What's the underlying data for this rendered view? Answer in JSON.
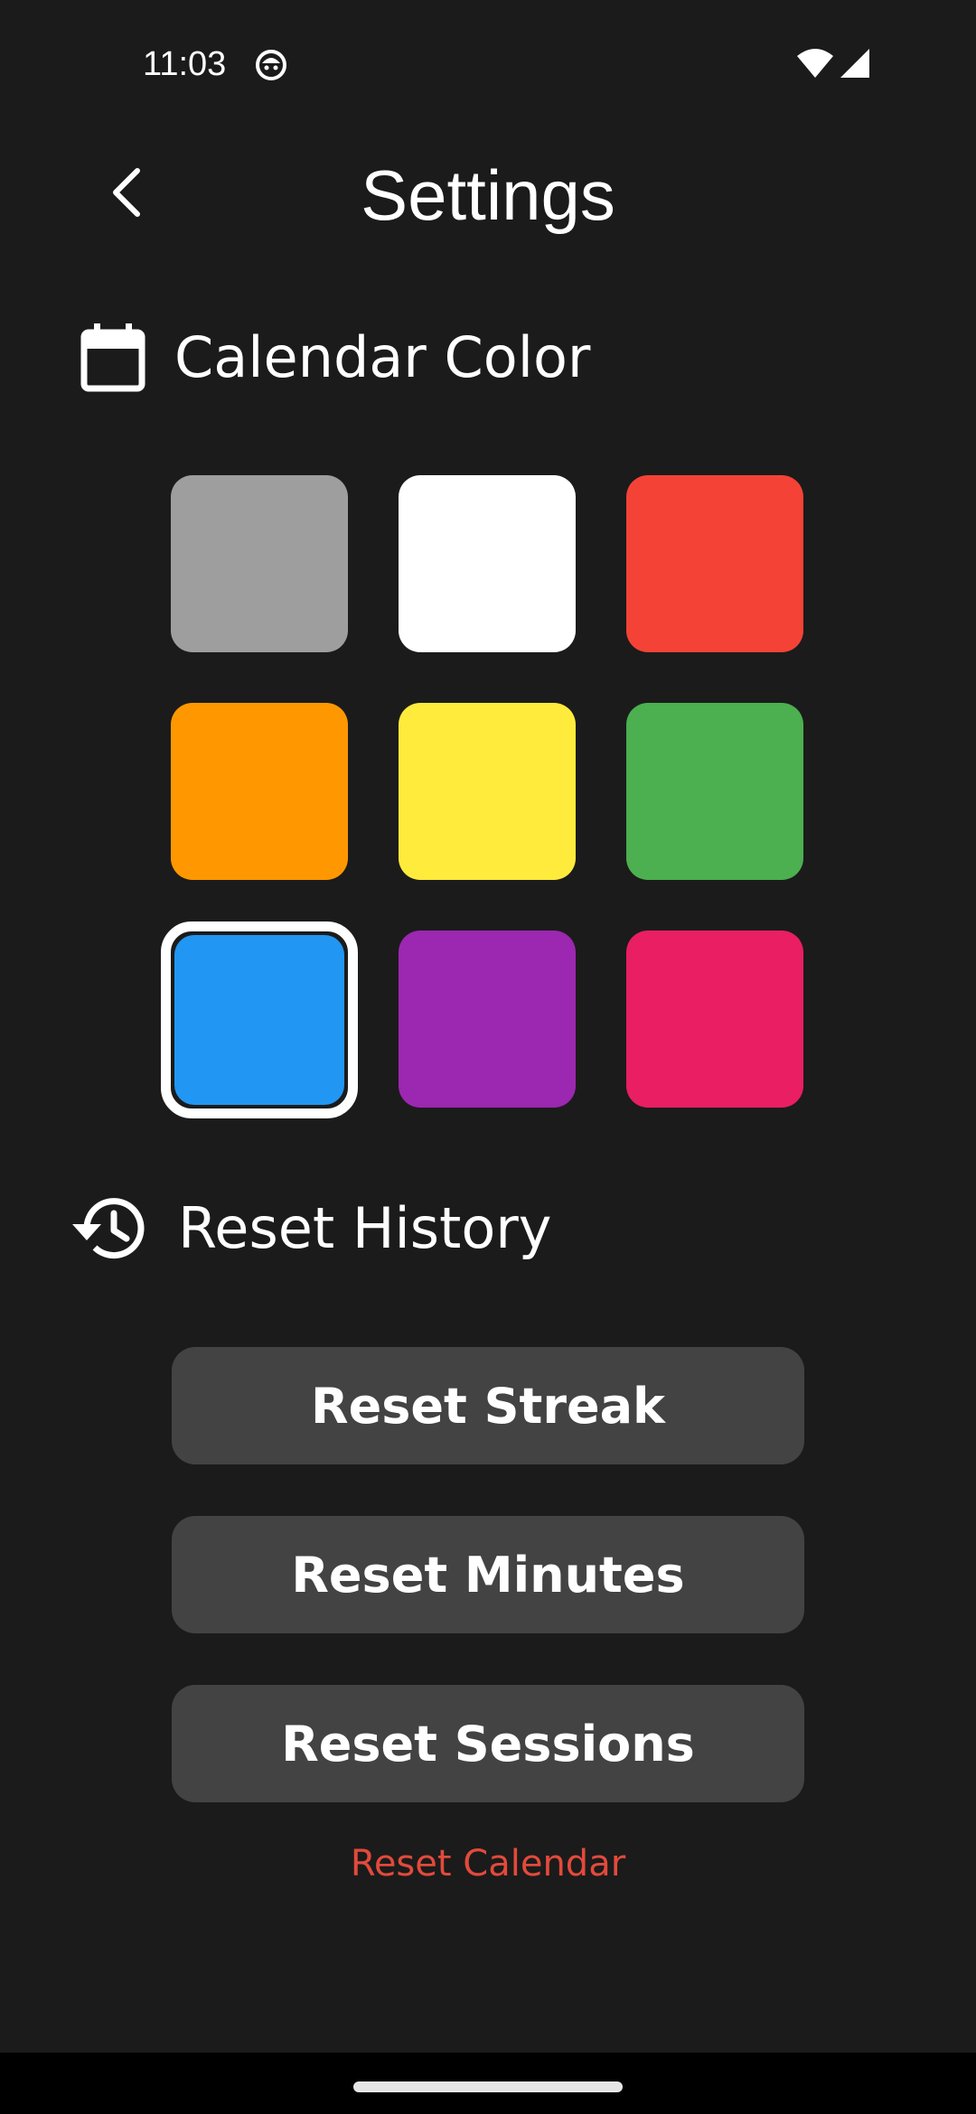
{
  "status_bar": {
    "time": "11:03",
    "icons": [
      "notification-face-icon",
      "wifi-icon",
      "signal-icon"
    ]
  },
  "header": {
    "back_icon": "chevron-left-icon",
    "title": "Settings"
  },
  "calendar_color": {
    "icon": "calendar-icon",
    "label": "Calendar Color",
    "selected_index": 6,
    "swatches": [
      {
        "name": "gray",
        "color": "#9e9e9e"
      },
      {
        "name": "white",
        "color": "#ffffff"
      },
      {
        "name": "red",
        "color": "#f44336"
      },
      {
        "name": "orange",
        "color": "#ff9800"
      },
      {
        "name": "yellow",
        "color": "#ffeb3b"
      },
      {
        "name": "green",
        "color": "#4caf50"
      },
      {
        "name": "blue",
        "color": "#2196f3"
      },
      {
        "name": "purple",
        "color": "#9c27b0"
      },
      {
        "name": "pink",
        "color": "#e91e63"
      }
    ]
  },
  "reset_history": {
    "icon": "history-icon",
    "label": "Reset History",
    "buttons": {
      "streak": "Reset Streak",
      "minutes": "Reset Minutes",
      "sessions": "Reset Sessions"
    },
    "calendar_link": "Reset Calendar"
  },
  "colors": {
    "background": "#1b1b1b",
    "button": "#434343",
    "danger": "#e24a3b"
  }
}
